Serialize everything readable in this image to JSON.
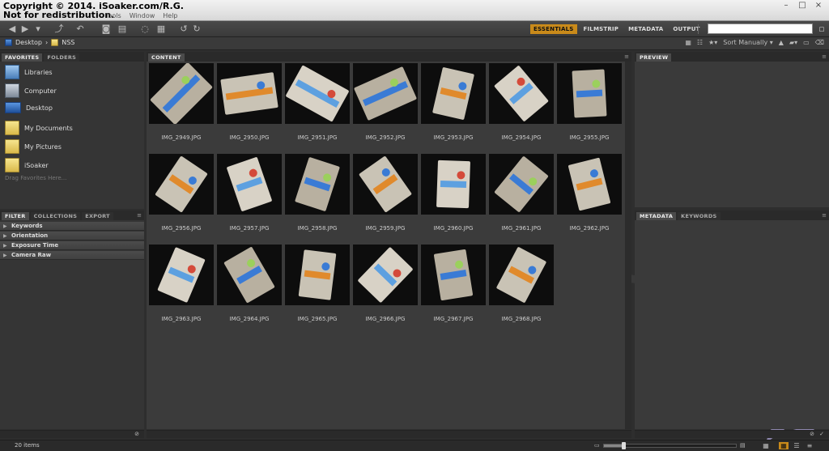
{
  "watermark": {
    "line1": "Copyright © 2014. iSoaker.com/R.G.",
    "line2": "Not for redistribution."
  },
  "menu": [
    "Tools",
    "Window",
    "Help"
  ],
  "window_controls": [
    "–",
    "□",
    "×"
  ],
  "workspaces": [
    {
      "label": "ESSENTIALS",
      "active": true
    },
    {
      "label": "FILMSTRIP",
      "active": false
    },
    {
      "label": "METADATA",
      "active": false
    },
    {
      "label": "OUTPUT",
      "active": false
    }
  ],
  "search": {
    "placeholder": ""
  },
  "breadcrumb": [
    {
      "label": "Desktop",
      "icon": "desktop-icon"
    },
    {
      "label": "NSS",
      "icon": "folder-icon"
    }
  ],
  "sort": {
    "label": "Sort Manually"
  },
  "favorites_panel": {
    "tabs": [
      {
        "label": "FAVORITES",
        "active": true
      },
      {
        "label": "FOLDERS",
        "active": false
      }
    ],
    "items": [
      {
        "label": "Libraries",
        "icon": "libraries-icon"
      },
      {
        "label": "Computer",
        "icon": "computer-icon"
      },
      {
        "label": "Desktop",
        "icon": "desktop-icon"
      },
      {
        "label": "My Documents",
        "icon": "folder-icon"
      },
      {
        "label": "My Pictures",
        "icon": "folder-icon"
      },
      {
        "label": "iSoaker",
        "icon": "folder-icon"
      }
    ],
    "drag_hint": "Drag Favorites Here..."
  },
  "filter_panel": {
    "tabs": [
      {
        "label": "FILTER",
        "active": true
      },
      {
        "label": "COLLECTIONS",
        "active": false
      },
      {
        "label": "EXPORT",
        "active": false
      }
    ],
    "rows": [
      "Keywords",
      "Orientation",
      "Exposure Time",
      "Camera Raw"
    ]
  },
  "content_panel": {
    "tab": "CONTENT",
    "thumbnails": [
      "IMG_2949.JPG",
      "IMG_2950.JPG",
      "IMG_2951.JPG",
      "IMG_2952.JPG",
      "IMG_2953.JPG",
      "IMG_2954.JPG",
      "IMG_2955.JPG",
      "IMG_2956.JPG",
      "IMG_2957.JPG",
      "IMG_2958.JPG",
      "IMG_2959.JPG",
      "IMG_2960.JPG",
      "IMG_2961.JPG",
      "IMG_2962.JPG",
      "IMG_2963.JPG",
      "IMG_2964.JPG",
      "IMG_2965.JPG",
      "IMG_2966.JPG",
      "IMG_2967.JPG",
      "IMG_2968.JPG"
    ]
  },
  "preview_panel": {
    "tab": "PREVIEW"
  },
  "metadata_panel": {
    "tabs": [
      {
        "label": "METADATA",
        "active": true
      },
      {
        "label": "KEYWORDS",
        "active": false
      }
    ]
  },
  "status": {
    "item_count": "20 items",
    "zoom_level": 0.15
  },
  "colors": {
    "accent": "#c98a1a",
    "panel": "#353535",
    "content": "#3b3b3b"
  }
}
